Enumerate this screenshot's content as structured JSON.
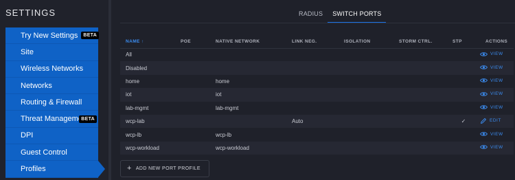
{
  "sidebar": {
    "title": "SETTINGS",
    "items": [
      {
        "label": "Try New Settings",
        "badge": "BETA"
      },
      {
        "label": "Site"
      },
      {
        "label": "Wireless Networks"
      },
      {
        "label": "Networks"
      },
      {
        "label": "Routing & Firewall"
      },
      {
        "label": "Threat Management",
        "badge": "BETA"
      },
      {
        "label": "DPI"
      },
      {
        "label": "Guest Control"
      },
      {
        "label": "Profiles"
      }
    ]
  },
  "tabs": [
    "RADIUS",
    "SWITCH PORTS"
  ],
  "active_tab": "SWITCH PORTS",
  "table": {
    "columns": [
      "NAME ↑",
      "POE",
      "NATIVE NETWORK",
      "LINK NEG.",
      "ISOLATION",
      "STORM CTRL.",
      "STP",
      "ACTIONS"
    ],
    "rows": [
      {
        "name": "All",
        "poe": "",
        "native": "",
        "link": "",
        "isolation": "",
        "storm": "",
        "stp": "",
        "action": "VIEW"
      },
      {
        "name": "Disabled",
        "poe": "",
        "native": "",
        "link": "",
        "isolation": "",
        "storm": "",
        "stp": "",
        "action": "VIEW"
      },
      {
        "name": "home",
        "poe": "",
        "native": "home",
        "link": "",
        "isolation": "",
        "storm": "",
        "stp": "",
        "action": "VIEW"
      },
      {
        "name": "iot",
        "poe": "",
        "native": "iot",
        "link": "",
        "isolation": "",
        "storm": "",
        "stp": "",
        "action": "VIEW"
      },
      {
        "name": "lab-mgmt",
        "poe": "",
        "native": "lab-mgmt",
        "link": "",
        "isolation": "",
        "storm": "",
        "stp": "",
        "action": "VIEW"
      },
      {
        "name": "wcp-lab",
        "poe": "",
        "native": "",
        "link": "Auto",
        "isolation": "",
        "storm": "",
        "stp": "✓",
        "action": "EDIT"
      },
      {
        "name": "wcp-lb",
        "poe": "",
        "native": "wcp-lb",
        "link": "",
        "isolation": "",
        "storm": "",
        "stp": "",
        "action": "VIEW"
      },
      {
        "name": "wcp-workload",
        "poe": "",
        "native": "wcp-workload",
        "link": "",
        "isolation": "",
        "storm": "",
        "stp": "",
        "action": "VIEW"
      }
    ]
  },
  "add_button": {
    "icon": "+",
    "label": "ADD NEW PORT PROFILE"
  },
  "colors": {
    "accent": "#1a73e8",
    "sidebar_active": "#0f62c6",
    "background": "#1f212a"
  }
}
